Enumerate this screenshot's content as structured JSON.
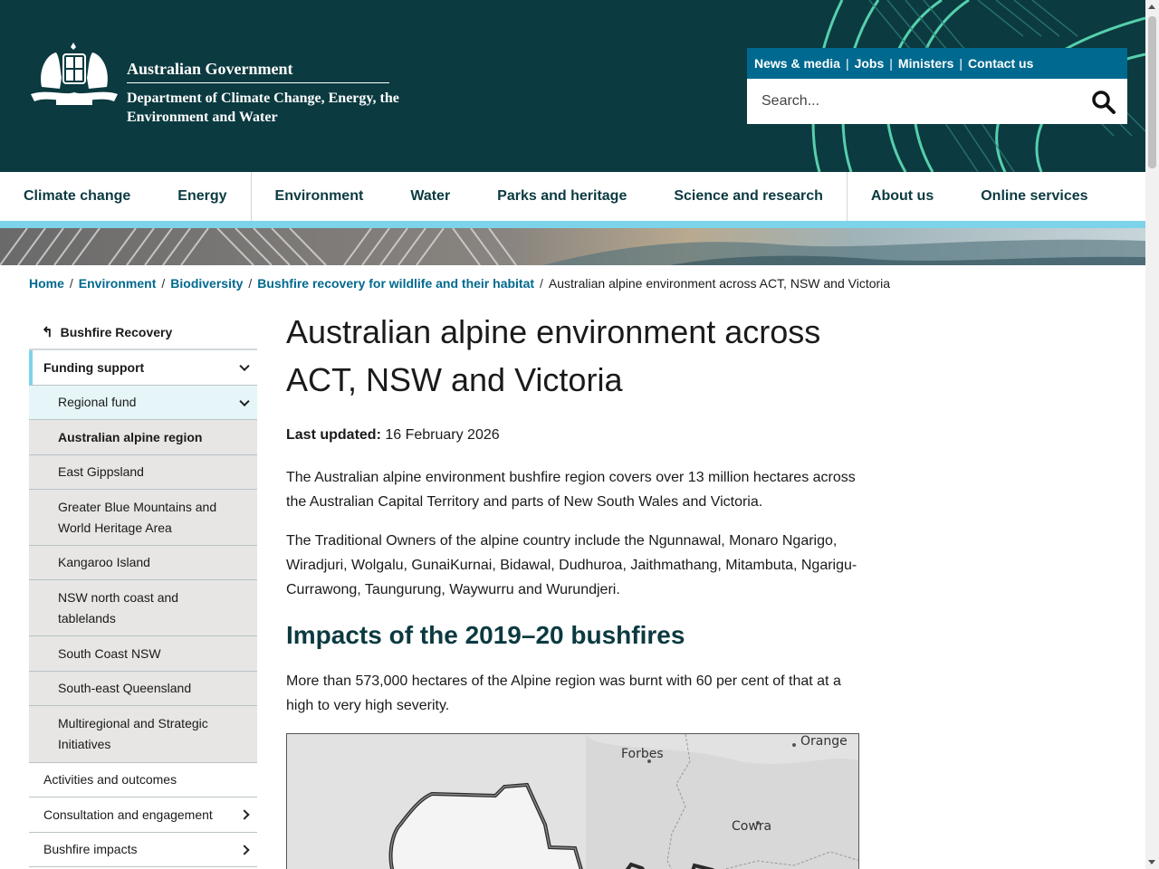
{
  "header": {
    "gov_title": "Australian Government",
    "dept_name": "Department of Climate Change, Energy, the Environment and Water",
    "utility_links": [
      "News & media",
      "Jobs",
      "Ministers",
      "Contact us"
    ],
    "search_placeholder": "Search..."
  },
  "nav": {
    "items": [
      "Climate change",
      "Energy",
      "Environment",
      "Water",
      "Parks and heritage",
      "Science and research",
      "About us",
      "Online services"
    ]
  },
  "breadcrumb": {
    "links": [
      "Home",
      "Environment",
      "Biodiversity",
      "Bushfire recovery for wildlife and their habitat"
    ],
    "current": "Australian alpine environment across ACT, NSW and Victoria"
  },
  "sidebar": {
    "back_label": "Bushfire Recovery",
    "items": [
      {
        "label": "Funding support",
        "level": 1,
        "state": "active",
        "chevron": "down"
      },
      {
        "label": "Regional fund",
        "level": 2,
        "state": "open",
        "chevron": "down"
      },
      {
        "label": "Australian alpine region",
        "level": 2,
        "state": "current",
        "chevron": ""
      },
      {
        "label": "East Gippsland",
        "level": 2,
        "state": "",
        "chevron": ""
      },
      {
        "label": "Greater Blue Mountains and World Heritage Area",
        "level": 2,
        "state": "",
        "chevron": ""
      },
      {
        "label": "Kangaroo Island",
        "level": 2,
        "state": "",
        "chevron": ""
      },
      {
        "label": "NSW north coast and tablelands",
        "level": 2,
        "state": "",
        "chevron": ""
      },
      {
        "label": "South Coast NSW",
        "level": 2,
        "state": "",
        "chevron": ""
      },
      {
        "label": "South-east Queensland",
        "level": 2,
        "state": "",
        "chevron": ""
      },
      {
        "label": "Multiregional and Strategic Initiatives",
        "level": 2,
        "state": "",
        "chevron": ""
      },
      {
        "label": "Activities and outcomes",
        "level": 1,
        "state": "",
        "chevron": ""
      },
      {
        "label": "Consultation and engagement",
        "level": 1,
        "state": "",
        "chevron": "right"
      },
      {
        "label": "Bushfire impacts",
        "level": 1,
        "state": "",
        "chevron": "right"
      }
    ]
  },
  "main": {
    "title": "Australian alpine environment across ACT, NSW and Victoria",
    "updated_label": "Last updated:",
    "updated_date": "16 February 2026",
    "paragraphs": [
      "The Australian alpine environment bushfire region covers over 13 million hectares across the Australian Capital Territory and parts of New South Wales and Victoria.",
      "The Traditional Owners of the alpine country include the Ngunnawal, Monaro Ngarigo, Wiradjuri, Wolgalu, GunaiKurnai, Bidawal, Dudhuroa, Jaithmathang, Mitambuta, Ngarigu-Currawong, Taungurung, Waywurru and Wurundjeri."
    ],
    "h2": "Impacts of the 2019–20 bushfires",
    "impact_paragraph": "More than 573,000 hectares of the Alpine region was burnt with 60 per cent of that at a high to very high severity."
  },
  "map": {
    "labels": [
      "Forbes",
      "Orange",
      "Cowra"
    ]
  },
  "colors": {
    "header_bg": "#0b3a40",
    "utility_bar": "#00698f",
    "accent": "#7dd3ea",
    "link": "#00698f",
    "heading": "#0b3a40"
  }
}
